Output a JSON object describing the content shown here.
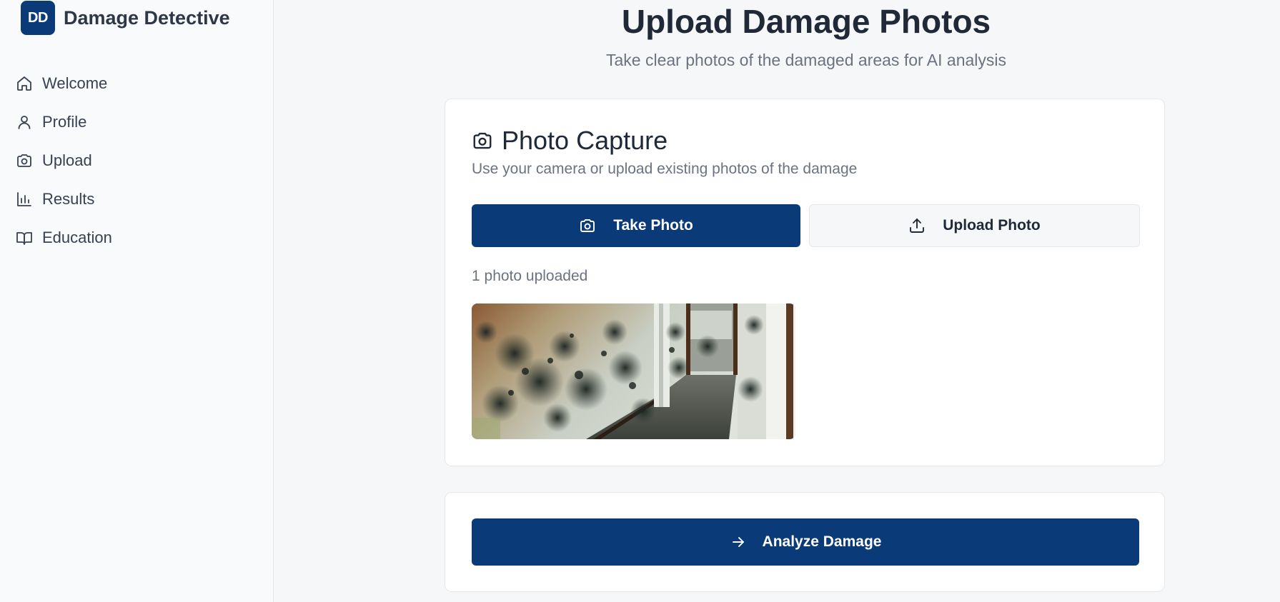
{
  "app": {
    "logo_text": "DD",
    "name": "Damage Detective"
  },
  "sidebar": {
    "items": [
      {
        "label": "Welcome",
        "icon": "home-icon"
      },
      {
        "label": "Profile",
        "icon": "user-icon"
      },
      {
        "label": "Upload",
        "icon": "camera-icon"
      },
      {
        "label": "Results",
        "icon": "bar-chart-icon"
      },
      {
        "label": "Education",
        "icon": "book-open-icon"
      }
    ]
  },
  "page": {
    "title": "Upload Damage Photos",
    "subtitle": "Take clear photos of the damaged areas for AI analysis"
  },
  "capture": {
    "title": "Photo Capture",
    "description": "Use your camera or upload existing photos of the damage",
    "take_photo_label": "Take Photo",
    "upload_photo_label": "Upload Photo",
    "upload_count": "1 photo uploaded"
  },
  "analyze": {
    "button_label": "Analyze Damage"
  },
  "colors": {
    "primary": "#0b3a78",
    "background": "#f6f7f9",
    "muted_text": "#6b7280"
  }
}
